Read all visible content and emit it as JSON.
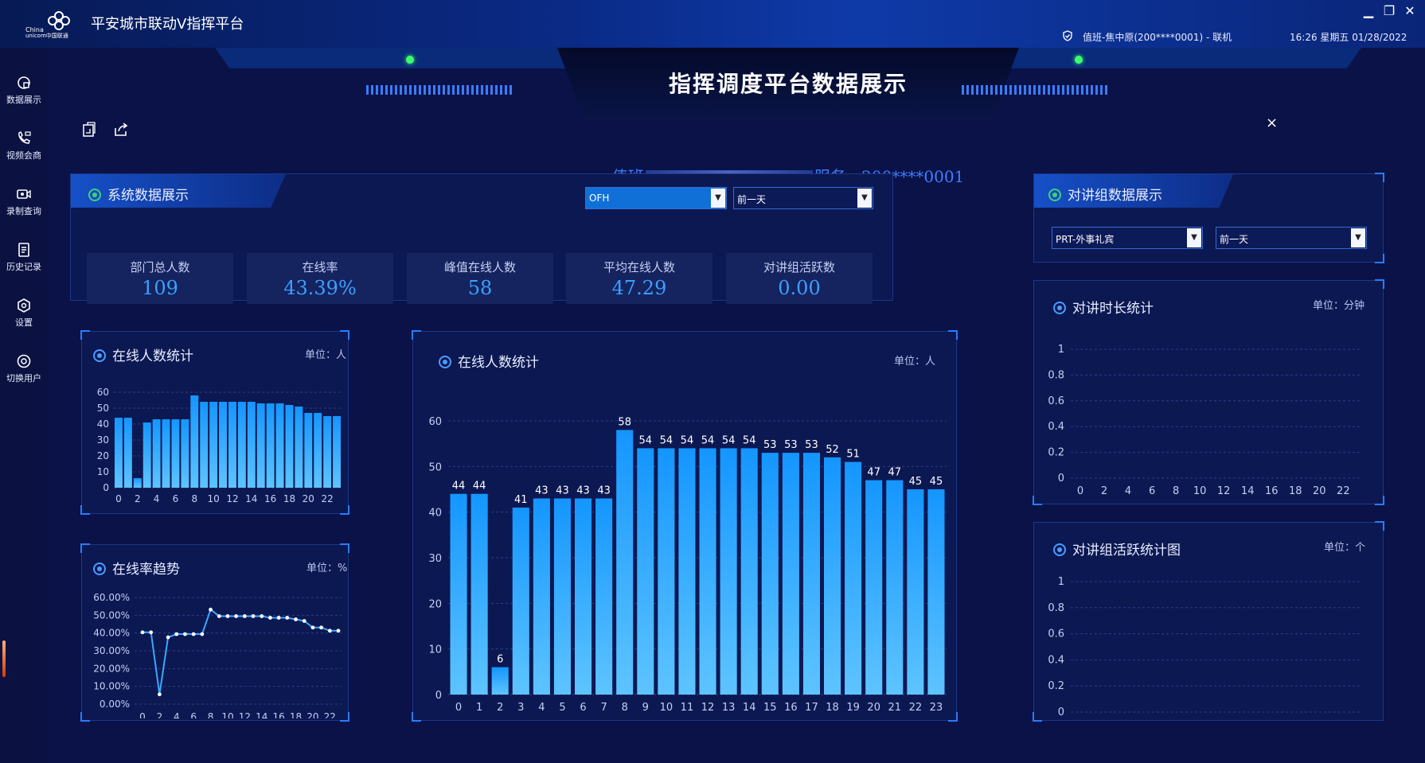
{
  "window": {
    "app_title": "平安城市联动V指挥平台",
    "user_info": "值班-焦中原(200****0001) - 联机",
    "datetime": "16:26 星期五 01/28/2022",
    "logo_text": "China unicom中国联通",
    "controls": {
      "minimize": "▁",
      "restore": "❐",
      "close": "✕"
    }
  },
  "sidebar": {
    "items": [
      {
        "label": "数据展示",
        "icon": "data-display-icon"
      },
      {
        "label": "视频会商",
        "icon": "video-call-icon"
      },
      {
        "label": "录制查询",
        "icon": "record-query-icon"
      },
      {
        "label": "历史记录",
        "icon": "history-icon"
      },
      {
        "label": "设置",
        "icon": "settings-icon"
      },
      {
        "label": "切换用户",
        "icon": "switch-user-icon"
      }
    ]
  },
  "header": {
    "title": "指挥调度平台数据展示",
    "duty_prefix": "值班",
    "duty_suffix": "服务 - 200****0001",
    "close": "×"
  },
  "system_panel": {
    "title": "系统数据展示",
    "group_select": "OFH",
    "range_select": "前一天",
    "stats": [
      {
        "label": "部门总人数",
        "value": "109"
      },
      {
        "label": "在线率",
        "value": "43.39%"
      },
      {
        "label": "峰值在线人数",
        "value": "58"
      },
      {
        "label": "平均在线人数",
        "value": "47.29"
      },
      {
        "label": "对讲组活跃数",
        "value": "0.00"
      }
    ]
  },
  "online_small": {
    "title": "在线人数统计",
    "unit": "单位：人"
  },
  "rate_panel": {
    "title": "在线率趋势",
    "unit": "单位：%"
  },
  "online_big": {
    "title": "在线人数统计",
    "unit": "单位：人"
  },
  "talk_panel": {
    "title": "对讲组数据展示",
    "group_select": "PRT-外事礼宾",
    "range_select": "前一天"
  },
  "duration_panel": {
    "title": "对讲时长统计",
    "unit": "单位：分钟"
  },
  "active_panel": {
    "title": "对讲组活跃统计图",
    "unit": "单位：个"
  },
  "chart_data": [
    {
      "id": "online-small",
      "type": "bar",
      "x": [
        0,
        1,
        2,
        3,
        4,
        5,
        6,
        7,
        8,
        9,
        10,
        11,
        12,
        13,
        14,
        15,
        16,
        17,
        18,
        19,
        20,
        21,
        22,
        23
      ],
      "values": [
        44,
        44,
        6,
        41,
        43,
        43,
        43,
        43,
        58,
        54,
        54,
        54,
        54,
        54,
        54,
        53,
        53,
        53,
        52,
        51,
        47,
        47,
        45,
        45
      ],
      "ylim": [
        0,
        60
      ],
      "yticks": [
        0,
        10,
        20,
        30,
        40,
        50,
        60
      ],
      "xticks": [
        0,
        2,
        4,
        6,
        8,
        10,
        12,
        14,
        16,
        18,
        20,
        22
      ]
    },
    {
      "id": "online-rate",
      "type": "line",
      "x": [
        0,
        1,
        2,
        3,
        4,
        5,
        6,
        7,
        8,
        9,
        10,
        11,
        12,
        13,
        14,
        15,
        16,
        17,
        18,
        19,
        20,
        21,
        22,
        23
      ],
      "values": [
        40.4,
        40.4,
        5.5,
        37.6,
        39.4,
        39.4,
        39.4,
        39.4,
        53.2,
        49.5,
        49.5,
        49.5,
        49.5,
        49.5,
        49.5,
        48.6,
        48.6,
        48.6,
        47.7,
        46.8,
        43.1,
        43.1,
        41.3,
        41.3
      ],
      "ylim": [
        0,
        60
      ],
      "yticks": [
        "0.00%",
        "10.00%",
        "20.00%",
        "30.00%",
        "40.00%",
        "50.00%",
        "60.00%"
      ],
      "xticks": [
        0,
        2,
        4,
        6,
        8,
        10,
        12,
        14,
        16,
        18,
        20,
        22
      ]
    },
    {
      "id": "online-big",
      "type": "bar",
      "x": [
        0,
        1,
        2,
        3,
        4,
        5,
        6,
        7,
        8,
        9,
        10,
        11,
        12,
        13,
        14,
        15,
        16,
        17,
        18,
        19,
        20,
        21,
        22,
        23
      ],
      "values": [
        44,
        44,
        6,
        41,
        43,
        43,
        43,
        43,
        58,
        54,
        54,
        54,
        54,
        54,
        54,
        53,
        53,
        53,
        52,
        51,
        47,
        47,
        45,
        45
      ],
      "ylim": [
        0,
        60
      ],
      "yticks": [
        0,
        10,
        20,
        30,
        40,
        50,
        60
      ]
    },
    {
      "id": "duration",
      "type": "line",
      "values": [],
      "ylim": [
        0,
        1
      ],
      "yticks": [
        "0",
        "0.2",
        "0.4",
        "0.6",
        "0.8",
        "1"
      ],
      "xticks": [
        0,
        2,
        4,
        6,
        8,
        10,
        12,
        14,
        16,
        18,
        20,
        22
      ]
    },
    {
      "id": "active",
      "type": "line",
      "values": [],
      "ylim": [
        0,
        1
      ],
      "yticks": [
        "0",
        "0.2",
        "0.4",
        "0.6",
        "0.8",
        "1"
      ],
      "xticks": [
        0,
        2,
        4,
        6,
        8,
        10,
        12,
        14,
        16,
        18,
        20,
        22
      ]
    }
  ]
}
